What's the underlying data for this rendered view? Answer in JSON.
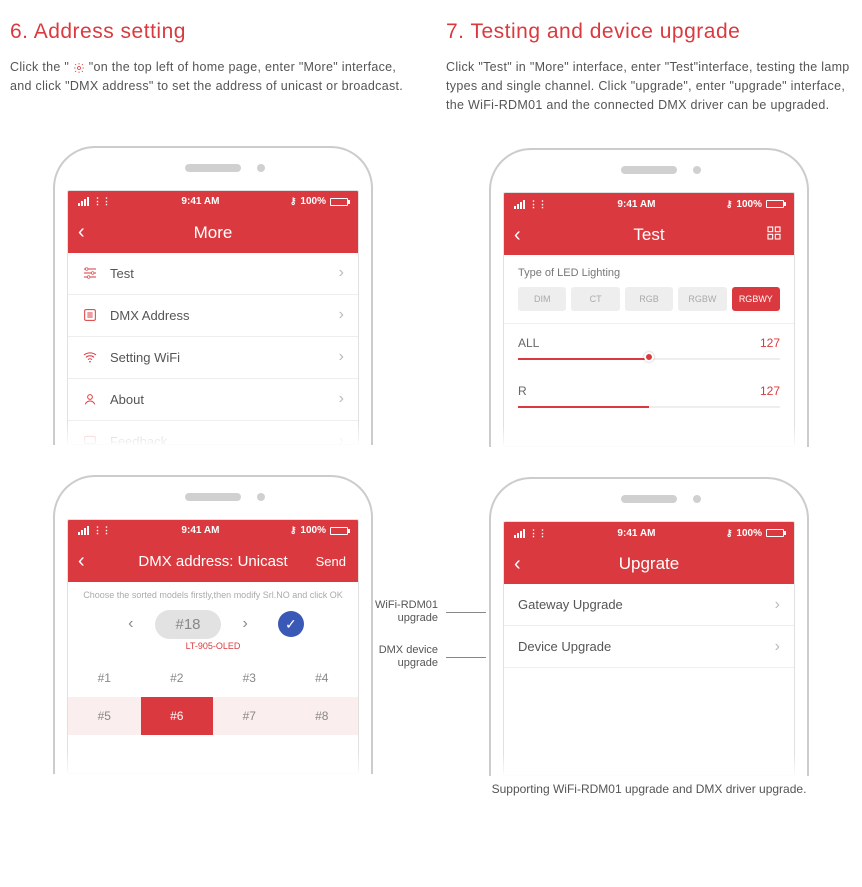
{
  "section6": {
    "title": "6. Address setting",
    "desc_before": "Click the \" ",
    "desc_after": " \"on the top left of home page, enter \"More\" interface, and click \"DMX address\" to set the address of unicast or broadcast."
  },
  "section7": {
    "title": "7. Testing and device upgrade",
    "desc": "Click \"Test\" in \"More\" interface, enter \"Test\"interface, testing the lamp types and single channel. Click \"upgrade\", enter \"upgrade\" interface, the WiFi-RDM01 and the connected DMX driver can be upgraded."
  },
  "status": {
    "time": "9:41 AM",
    "battery": "100%"
  },
  "more_screen": {
    "title": "More",
    "items": [
      {
        "label": "Test"
      },
      {
        "label": "DMX Address"
      },
      {
        "label": "Setting WiFi"
      },
      {
        "label": "About"
      },
      {
        "label": "Feedback"
      }
    ]
  },
  "dmx_screen": {
    "title": "DMX address: Unicast",
    "send": "Send",
    "hint": "Choose the sorted models firstly,then modify Srl.NO and click OK",
    "picker_value": "#18",
    "model": "LT-905-OLED",
    "cells": [
      "#1",
      "#2",
      "#3",
      "#4",
      "#5",
      "#6",
      "#7",
      "#8"
    ],
    "selected_index": 5
  },
  "test_screen": {
    "title": "Test",
    "type_label": "Type of LED Lighting",
    "segs": [
      "DIM",
      "CT",
      "RGB",
      "RGBW",
      "RGBWY"
    ],
    "seg_active": 4,
    "sliders": [
      {
        "label": "ALL",
        "value": "127",
        "pct": 50
      },
      {
        "label": "R",
        "value": "127",
        "pct": 50
      }
    ]
  },
  "upgrade_screen": {
    "title": "Upgrate",
    "items": [
      {
        "label": "Gateway Upgrade"
      },
      {
        "label": "Device Upgrade"
      }
    ],
    "callout1": "WiFi-RDM01 upgrade",
    "callout2": "DMX device upgrade",
    "caption": "Supporting WiFi-RDM01 upgrade and DMX driver upgrade."
  }
}
